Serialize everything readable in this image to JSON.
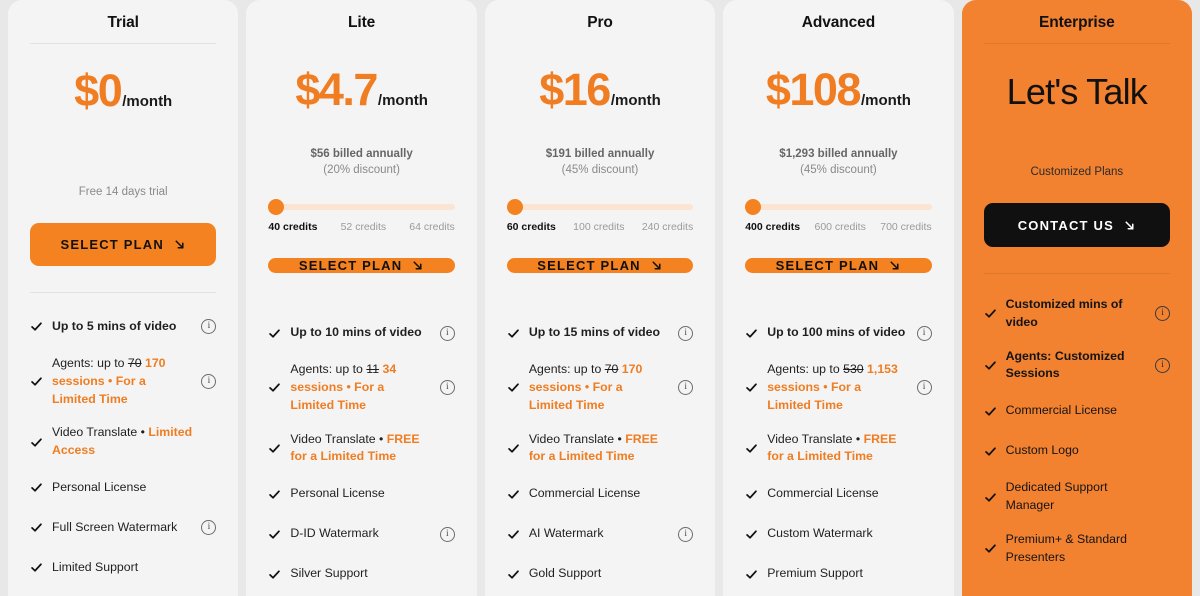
{
  "theme": {
    "accent": "#f58220",
    "enterprise_bg": "#f28130",
    "card_bg": "#f4f4f4",
    "page_bg": "#e8e8e8",
    "highlight_text": "#ef7d22",
    "dark_button_bg": "#101010"
  },
  "plans": [
    {
      "name": "Trial",
      "price": "$0",
      "period": "/month",
      "billed": "",
      "discount": "",
      "note": "Free 14 days trial",
      "slider": null,
      "cta": {
        "label": "SELECT PLAN",
        "icon": "arrow-down-right-icon",
        "style": "orange"
      },
      "features": [
        {
          "text": "Up to 5 mins of video",
          "bold": true,
          "info": true
        },
        {
          "parts": [
            {
              "t": "Agents: up to ",
              "s": "plain"
            },
            {
              "t": "70",
              "s": "strike"
            },
            {
              "t": " 170 sessions • For a Limited Time",
              "s": "highlight"
            }
          ],
          "info": true
        },
        {
          "parts": [
            {
              "t": "Video Translate • ",
              "s": "plain"
            },
            {
              "t": "Limited Access",
              "s": "highlight"
            }
          ],
          "info": false
        },
        {
          "text": "Personal License",
          "info": false
        },
        {
          "text": "Full Screen Watermark",
          "info": true
        },
        {
          "text": "Limited Support",
          "info": false
        }
      ]
    },
    {
      "name": "Lite",
      "price": "$4.7",
      "period": "/month",
      "billed": "$56 billed annually",
      "discount": "(20% discount)",
      "note": "",
      "slider": {
        "value": 0,
        "labels": [
          "40 credits",
          "52 credits",
          "64 credits"
        ],
        "active_index": 0
      },
      "cta": {
        "label": "SELECT PLAN",
        "icon": "arrow-down-right-icon",
        "style": "orange"
      },
      "features": [
        {
          "text": "Up to 10 mins of video",
          "bold": true,
          "info": true
        },
        {
          "parts": [
            {
              "t": "Agents: up to ",
              "s": "plain"
            },
            {
              "t": "11",
              "s": "strike"
            },
            {
              "t": " 34 sessions • For a Limited Time",
              "s": "highlight"
            }
          ],
          "info": true
        },
        {
          "parts": [
            {
              "t": "Video Translate • ",
              "s": "plain"
            },
            {
              "t": "FREE for a Limited Time",
              "s": "highlight"
            }
          ],
          "info": false
        },
        {
          "text": "Personal License",
          "info": false
        },
        {
          "text": "D-ID Watermark",
          "info": true
        },
        {
          "text": "Silver Support",
          "info": false
        }
      ]
    },
    {
      "name": "Pro",
      "price": "$16",
      "period": "/month",
      "billed": "$191 billed annually",
      "discount": "(45% discount)",
      "note": "",
      "slider": {
        "value": 0,
        "labels": [
          "60 credits",
          "100 credits",
          "240 credits"
        ],
        "active_index": 0
      },
      "cta": {
        "label": "SELECT PLAN",
        "icon": "arrow-down-right-icon",
        "style": "orange"
      },
      "features": [
        {
          "text": "Up to 15 mins of video",
          "bold": true,
          "info": true
        },
        {
          "parts": [
            {
              "t": "Agents: up to ",
              "s": "plain"
            },
            {
              "t": "70",
              "s": "strike"
            },
            {
              "t": " 170 sessions • For a Limited Time",
              "s": "highlight"
            }
          ],
          "info": true
        },
        {
          "parts": [
            {
              "t": "Video Translate • ",
              "s": "plain"
            },
            {
              "t": "FREE for a Limited Time",
              "s": "highlight"
            }
          ],
          "info": false
        },
        {
          "text": "Commercial License",
          "info": false
        },
        {
          "text": "AI Watermark",
          "info": true
        },
        {
          "text": "Gold Support",
          "info": false
        }
      ]
    },
    {
      "name": "Advanced",
      "price": "$108",
      "period": "/month",
      "billed": "$1,293 billed annually",
      "discount": "(45% discount)",
      "note": "",
      "slider": {
        "value": 0,
        "labels": [
          "400 credits",
          "600 credits",
          "700 credits"
        ],
        "active_index": 0
      },
      "cta": {
        "label": "SELECT PLAN",
        "icon": "arrow-down-right-icon",
        "style": "orange"
      },
      "features": [
        {
          "text": "Up to 100 mins of video",
          "bold": true,
          "info": true
        },
        {
          "parts": [
            {
              "t": "Agents: up to ",
              "s": "plain"
            },
            {
              "t": "530",
              "s": "strike"
            },
            {
              "t": " 1,153 sessions • For a Limited Time",
              "s": "highlight"
            }
          ],
          "info": true
        },
        {
          "parts": [
            {
              "t": "Video Translate • ",
              "s": "plain"
            },
            {
              "t": "FREE for a Limited Time",
              "s": "highlight"
            }
          ],
          "info": false
        },
        {
          "text": "Commercial License",
          "info": false
        },
        {
          "text": "Custom Watermark",
          "info": false
        },
        {
          "text": "Premium Support",
          "info": false
        }
      ]
    },
    {
      "name": "Enterprise",
      "price": "",
      "period": "",
      "headline": "Let's Talk",
      "billed": "",
      "discount": "",
      "note": "Customized Plans",
      "slider": null,
      "cta": {
        "label": "CONTACT US",
        "icon": "arrow-down-right-icon",
        "style": "dark"
      },
      "features": [
        {
          "text": "Customized mins of video",
          "bold": true,
          "info": true
        },
        {
          "text": "Agents: Customized Sessions",
          "bold": true,
          "info": true
        },
        {
          "text": "Commercial License",
          "info": false
        },
        {
          "text": "Custom Logo",
          "info": false
        },
        {
          "text": "Dedicated Support Manager",
          "info": false
        },
        {
          "text": "Premium+ & Standard Presenters",
          "info": false
        }
      ]
    }
  ]
}
